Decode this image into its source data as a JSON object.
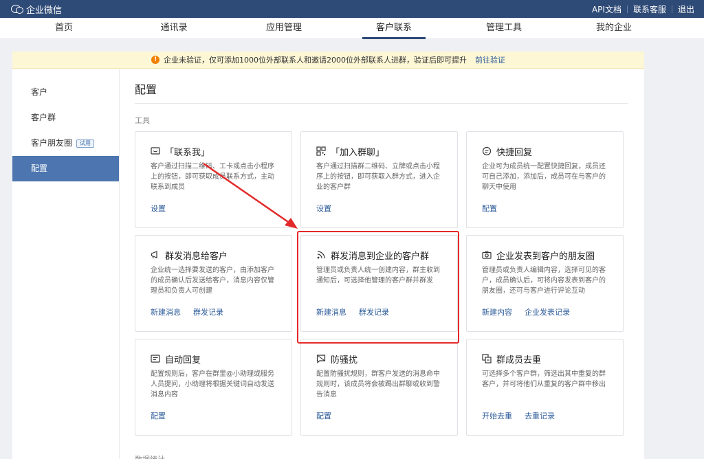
{
  "topbar": {
    "brand": "企业微信",
    "links": [
      "API文档",
      "联系客服",
      "退出"
    ]
  },
  "nav": {
    "items": [
      "首页",
      "通讯录",
      "应用管理",
      "客户联系",
      "管理工具",
      "我的企业"
    ],
    "active": "客户联系"
  },
  "notice": {
    "text": "企业未验证，仅可添加1000位外部联系人和邀请2000位外部联系人进群，验证后即可提升",
    "link": "前往验证"
  },
  "sidebar": {
    "items": [
      {
        "label": "客户"
      },
      {
        "label": "客户群"
      },
      {
        "label": "客户朋友圈",
        "badge": "试用"
      },
      {
        "label": "配置"
      }
    ],
    "active": "配置"
  },
  "main": {
    "title": "配置",
    "section_label": "工具",
    "bottom_label": "数据统计"
  },
  "cards": [
    {
      "title": "「联系我」",
      "icon": "chat-bubble-icon",
      "desc": "客户通过扫描二维码、工卡或点击小程序上的按钮，即可获取成员联系方式，主动联系到成员",
      "links": [
        "设置"
      ]
    },
    {
      "title": "「加入群聊」",
      "icon": "qrcode-icon",
      "desc": "客户通过扫描群二维码、立牌或点击小程序上的按钮，即可获取入群方式，进入企业的客户群",
      "links": [
        "设置"
      ]
    },
    {
      "title": "快捷回复",
      "icon": "quick-reply-icon",
      "desc": "企业可为成员统一配置快捷回复，成员还可自己添加，添加后，成员可在与客户的聊天中使用",
      "links": [
        "配置"
      ]
    },
    {
      "title": "群发消息给客户",
      "icon": "megaphone-icon",
      "desc": "企业统一选择要发送的客户，由添加客户的成员确认后发送给客户，消息内容仅管理员和负责人可创建",
      "links": [
        "新建消息",
        "群发记录"
      ]
    },
    {
      "title": "群发消息到企业的客户群",
      "icon": "broadcast-icon",
      "desc": "管理员或负责人统一创建内容，群主收到通知后，可选择他管理的客户群并群发",
      "links": [
        "新建消息",
        "群发记录"
      ]
    },
    {
      "title": "企业发表到客户的朋友圈",
      "icon": "camera-icon",
      "desc": "管理员或负责人编辑内容，选择可见的客户，成员确认后，可将内容发表到客户的朋友圈，还可与客户进行评论互动",
      "links": [
        "新建内容",
        "企业发表记录"
      ]
    },
    {
      "title": "自动回复",
      "icon": "auto-reply-icon",
      "desc": "配置规则后，客户在群里@小助理或服务人员提问，小助理将根据关键词自动发送消息内容",
      "links": [
        "配置"
      ]
    },
    {
      "title": "防骚扰",
      "icon": "shield-icon",
      "desc": "配置防骚扰规则，群客户发送的消息命中规则时，该成员将会被踢出群聊或收到警告消息",
      "links": [
        "配置"
      ]
    },
    {
      "title": "群成员去重",
      "icon": "dedupe-icon",
      "desc": "可选择多个客户群，筛选出其中重复的群客户，并可将他们从重复的客户群中移出",
      "links": [
        "开始去重",
        "去重记录"
      ]
    }
  ]
}
